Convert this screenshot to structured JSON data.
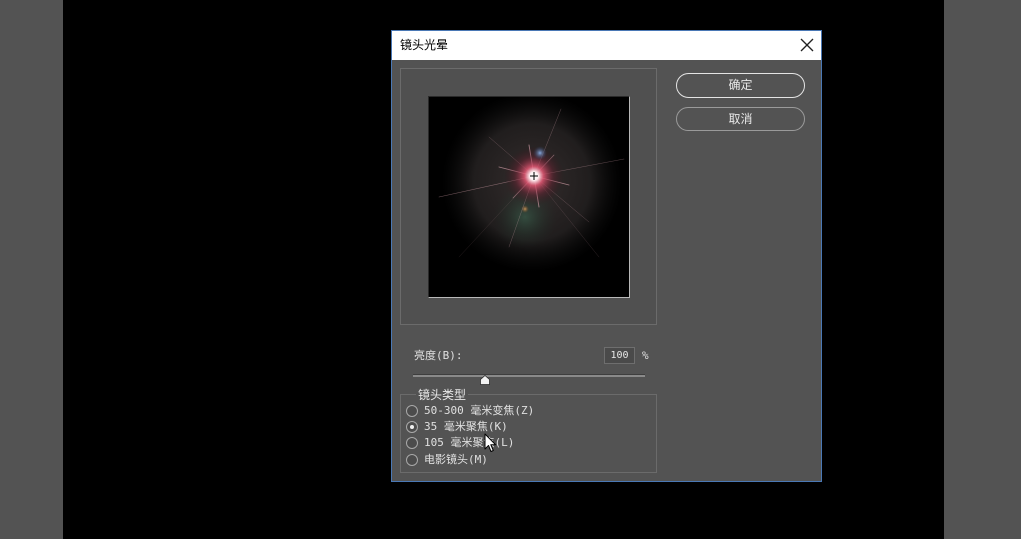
{
  "dialog": {
    "title": "镜头光晕",
    "ok_label": "确定",
    "cancel_label": "取消"
  },
  "brightness": {
    "label": "亮度(B):",
    "value": 100,
    "unit": "%"
  },
  "lens_type": {
    "legend": "镜头类型",
    "options": [
      {
        "label": "50-300 毫米变焦(Z)",
        "selected": false
      },
      {
        "label": "35 毫米聚焦(K)",
        "selected": true
      },
      {
        "label": "105 毫米聚焦(L)",
        "selected": false
      },
      {
        "label": "电影镜头(M)",
        "selected": false
      }
    ]
  },
  "icons": {
    "close": "close-icon",
    "cursor": "mouse-cursor-icon",
    "slider_thumb": "slider-thumb-icon"
  },
  "colors": {
    "panel": "#535353",
    "canvas": "#000000",
    "title_bar": "#ffffff",
    "dialog_border": "#4a78b5",
    "text": "#e0e0e0"
  }
}
